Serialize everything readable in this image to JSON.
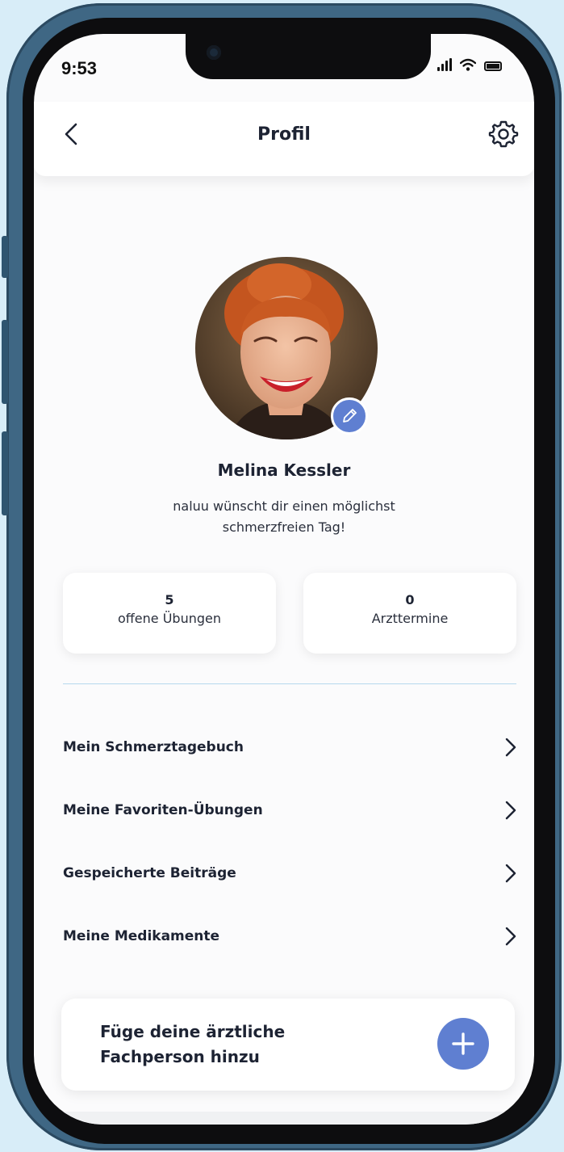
{
  "status_bar": {
    "time": "9:53"
  },
  "header": {
    "title": "Profil"
  },
  "profile": {
    "name": "Melina Kessler",
    "greeting_line1": "naluu wünscht dir einen möglichst",
    "greeting_line2": "schmerzfreien Tag!"
  },
  "stats": [
    {
      "value": "5",
      "label": "offene Übungen"
    },
    {
      "value": "0",
      "label": "Arzttermine"
    }
  ],
  "menu": [
    {
      "label": "Mein Schmerztagebuch"
    },
    {
      "label": "Meine Favoriten-Übungen"
    },
    {
      "label": "Gespeicherte Beiträge"
    },
    {
      "label": "Meine Medikamente"
    }
  ],
  "add_card": {
    "line1": "Füge deine ärztliche",
    "line2": "Fachperson hinzu"
  },
  "colors": {
    "accent": "#5f7fd1",
    "divider": "#b6d8ee",
    "text": "#1d2333",
    "frame": "#3f6784",
    "backdrop": "#d8edf8"
  },
  "icons": [
    "back-icon",
    "gear-icon",
    "pencil-icon",
    "chevron-right-icon",
    "plus-icon",
    "signal-icon",
    "wifi-icon",
    "battery-icon"
  ]
}
